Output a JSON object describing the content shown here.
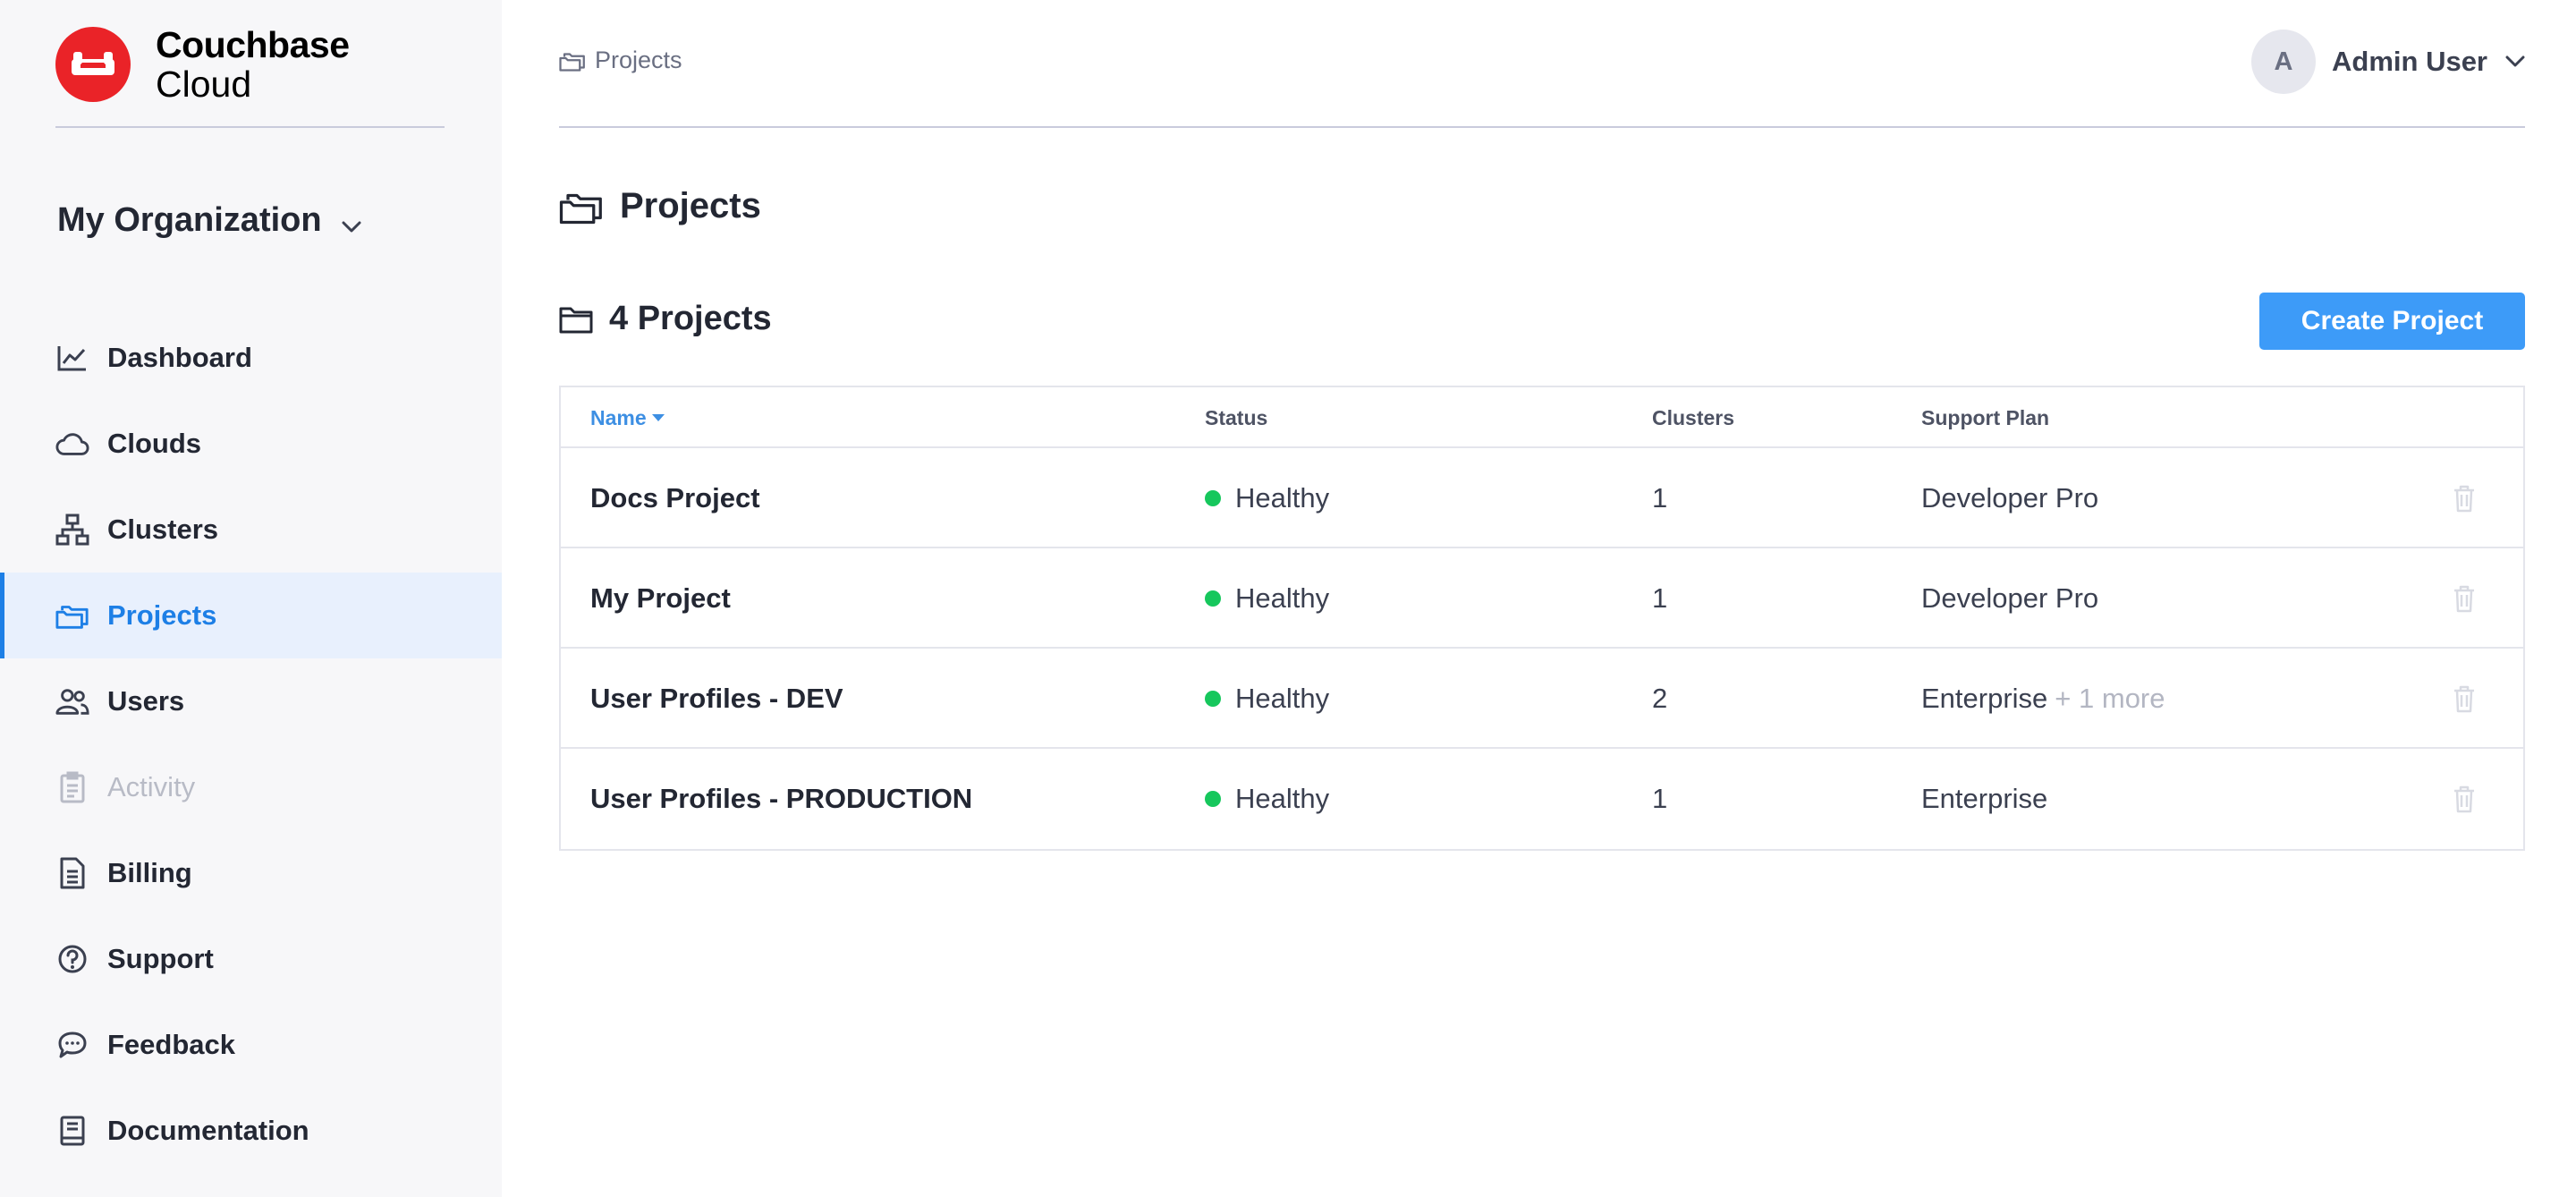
{
  "brand": {
    "line1": "Couchbase",
    "line2": "Cloud",
    "color": "#ea2328"
  },
  "org": {
    "name": "My Organization",
    "icon": "chevron-down-icon"
  },
  "nav": {
    "items": [
      {
        "label": "Dashboard",
        "icon": "chart-line-icon"
      },
      {
        "label": "Clouds",
        "icon": "cloud-icon"
      },
      {
        "label": "Clusters",
        "icon": "cluster-icon"
      },
      {
        "label": "Projects",
        "icon": "folders-icon",
        "active": true
      },
      {
        "label": "Users",
        "icon": "users-icon"
      },
      {
        "label": "Activity",
        "icon": "clipboard-icon",
        "disabled": true
      },
      {
        "label": "Billing",
        "icon": "receipt-icon"
      },
      {
        "label": "Support",
        "icon": "help-circle-icon"
      },
      {
        "label": "Feedback",
        "icon": "chat-icon"
      },
      {
        "label": "Documentation",
        "icon": "book-icon"
      }
    ]
  },
  "header": {
    "breadcrumb": "Projects",
    "user": {
      "initial": "A",
      "name": "Admin User"
    }
  },
  "main": {
    "title": "Projects",
    "count_title": "4 Projects",
    "create_label": "Create Project",
    "accent": "#3d9bf8"
  },
  "table": {
    "columns": {
      "name": "Name",
      "status": "Status",
      "clusters": "Clusters",
      "plan": "Support Plan"
    },
    "rows": [
      {
        "name": "Docs Project",
        "status": "Healthy",
        "clusters": "1",
        "plan": "Developer Pro",
        "more": ""
      },
      {
        "name": "My Project",
        "status": "Healthy",
        "clusters": "1",
        "plan": "Developer Pro",
        "more": ""
      },
      {
        "name": "User Profiles - DEV",
        "status": "Healthy",
        "clusters": "2",
        "plan": "Enterprise",
        "more": "+ 1 more"
      },
      {
        "name": "User Profiles - PRODUCTION",
        "status": "Healthy",
        "clusters": "1",
        "plan": "Enterprise",
        "more": ""
      }
    ],
    "status_color": "#16c75c"
  }
}
